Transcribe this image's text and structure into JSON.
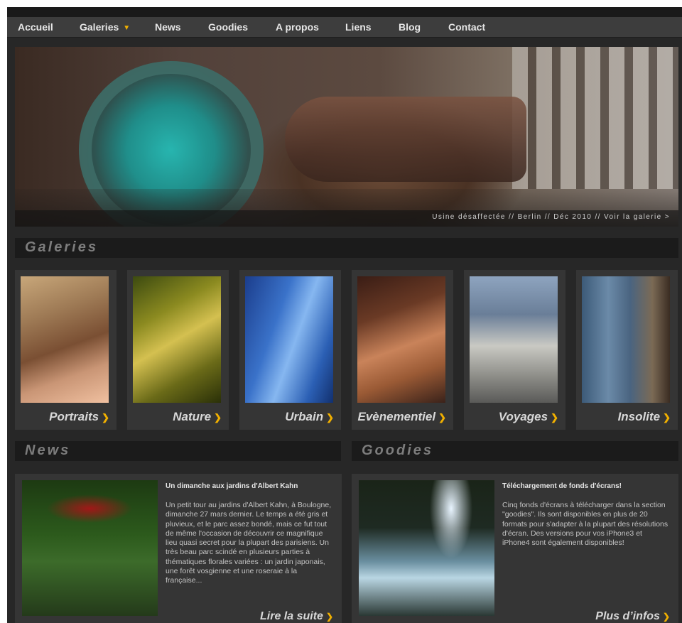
{
  "nav": {
    "items": [
      "Accueil",
      "Galeries",
      "News",
      "Goodies",
      "A propos",
      "Liens",
      "Blog",
      "Contact"
    ]
  },
  "hero": {
    "caption": "Usine désaffectée // Berlin // Déc 2010 // Voir la galerie >"
  },
  "sections": {
    "galeries": "Galeries",
    "news": "News",
    "goodies": "Goodies"
  },
  "galleries": [
    {
      "label": "Portraits"
    },
    {
      "label": "Nature"
    },
    {
      "label": "Urbain"
    },
    {
      "label": "Evènementiel"
    },
    {
      "label": "Voyages"
    },
    {
      "label": "Insolite"
    }
  ],
  "news": {
    "title": "Un dimanche aux jardins d'Albert Kahn",
    "body": "Un petit tour au jardins d'Albert Kahn, à Boulogne, dimanche 27 mars dernier. Le temps a été gris et pluvieux, et le parc assez bondé, mais ce fut tout de même l'occasion de découvrir ce magnifique lieu quasi secret pour la plupart des parisiens. Un très beau parc scindé en plusieurs parties à thématiques florales variées : un jardin japonais, une forêt vosgienne et une roseraie à la française...",
    "more": "Lire la suite"
  },
  "goodies": {
    "title": "Téléchargement de fonds d'écrans!",
    "body": "Cinq fonds d'écrans à télécharger dans la section \"goodies\". Ils sont disponibles en plus de 20 formats pour s'adapter à la plupart des résolutions d'écran. Des versions pour vos iPhone3 et iPhone4 sont également disponibles!",
    "more": "Plus d’infos"
  },
  "colors": {
    "accent": "#f1b000",
    "background": "#272727",
    "panel": "#353535"
  }
}
